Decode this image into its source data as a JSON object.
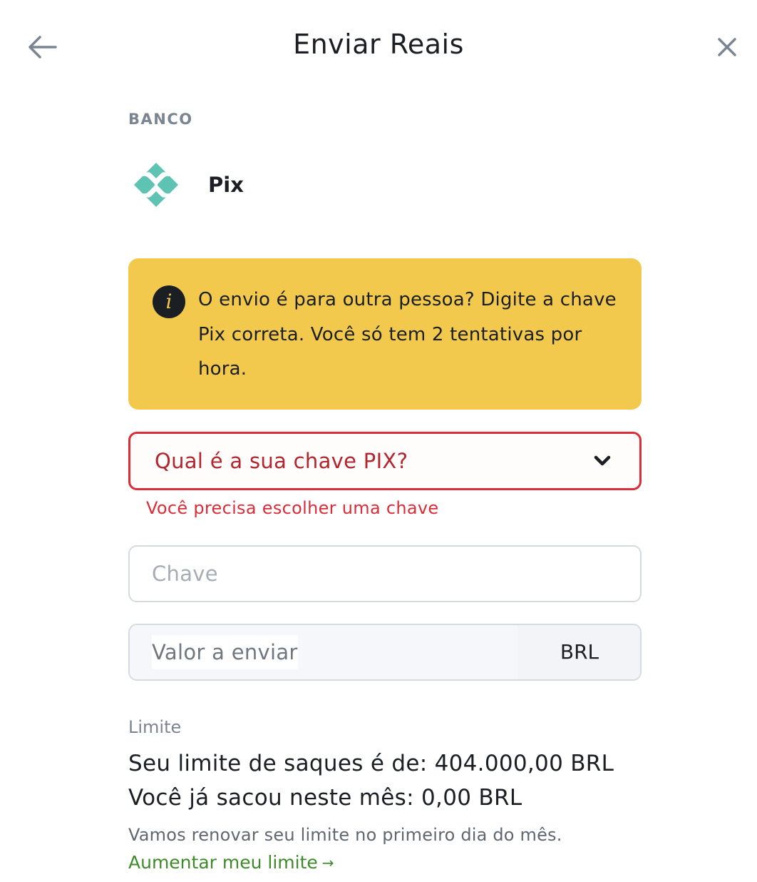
{
  "header": {
    "title": "Enviar Reais",
    "back_icon": "arrow-left-icon",
    "close_icon": "close-icon"
  },
  "bank": {
    "section_label": "BANCO",
    "name": "Pix",
    "logo_icon": "pix-logo-icon"
  },
  "alert": {
    "icon": "info-icon",
    "text": "O envio é para outra pessoa? Digite a chave Pix correta. Você só tem 2 tentativas por hora.",
    "background_color": "#f2c94c"
  },
  "key_type_select": {
    "placeholder": "Qual é a sua chave PIX?",
    "error": "Você precisa escolher uma chave",
    "error_color": "#d92d3a"
  },
  "key_input": {
    "placeholder": "Chave",
    "value": ""
  },
  "amount_input": {
    "placeholder": "Valor a enviar",
    "value": "",
    "currency": "BRL"
  },
  "limit": {
    "label": "Limite",
    "withdraw_limit": "Seu limite de saques é de: 404.000,00 BRL",
    "withdrawn_this_month": "Você já sacou neste mês: 0,00 BRL",
    "renew_note": "Vamos renovar seu limite no primeiro dia do mês.",
    "increase_link": "Aumentar meu limite",
    "increase_link_arrow": "→",
    "link_color": "#3f8a2a"
  }
}
